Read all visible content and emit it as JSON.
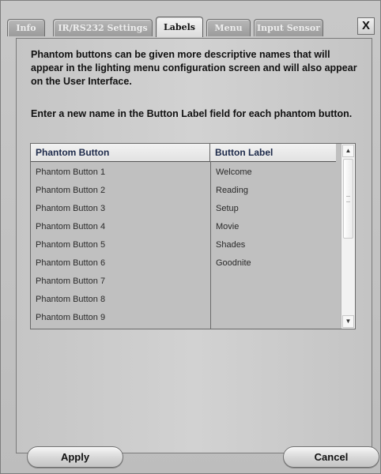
{
  "tabs": [
    {
      "label": "Info"
    },
    {
      "label": "IR/RS232 Settings"
    },
    {
      "label": "Labels"
    },
    {
      "label": "Menu"
    },
    {
      "label": "Input Sensor"
    }
  ],
  "active_tab": "Labels",
  "close_label": "X",
  "description": {
    "p1": "Phantom buttons can be given more descriptive names that will appear in the lighting menu configuration screen and will also appear on the User Interface.",
    "p2": "Enter a new name in the Button Label field for each phantom button."
  },
  "table": {
    "headers": [
      "Phantom Button",
      "Button Label"
    ],
    "rows": [
      {
        "button": "Phantom Button 1",
        "label": "Welcome"
      },
      {
        "button": "Phantom Button 2",
        "label": "Reading"
      },
      {
        "button": "Phantom Button 3",
        "label": "Setup"
      },
      {
        "button": "Phantom Button 4",
        "label": "Movie"
      },
      {
        "button": "Phantom Button 5",
        "label": "Shades"
      },
      {
        "button": "Phantom Button 6",
        "label": "Goodnite"
      },
      {
        "button": "Phantom Button 7",
        "label": ""
      },
      {
        "button": "Phantom Button 8",
        "label": ""
      },
      {
        "button": "Phantom Button 9",
        "label": ""
      }
    ]
  },
  "scrollbar": {
    "up_icon": "up-arrow-icon",
    "down_icon": "down-arrow-icon"
  },
  "footer": {
    "apply_label": "Apply",
    "cancel_label": "Cancel"
  }
}
